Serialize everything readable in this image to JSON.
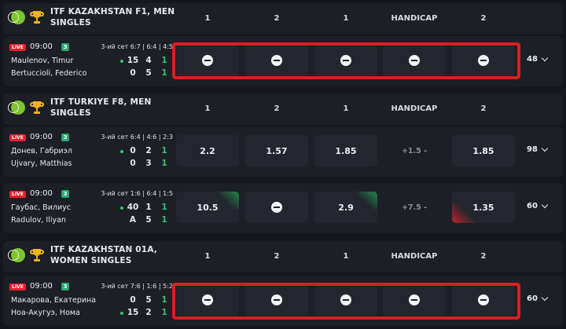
{
  "columns": [
    "1",
    "2",
    "1",
    "HANDICAP",
    "2"
  ],
  "sections": [
    {
      "title": "ITF KAZAKHSTAN F1, MEN SINGLES",
      "events": [
        {
          "live_badge": "LIVE",
          "time": "09:00",
          "live_icon_label": "3",
          "set_info": "3-ий сет 6:7 | 6:4 | 4:5",
          "home": "Maulenov, Timur",
          "away": "Bertuccioli, Federico",
          "home_score": [
            "15",
            "4",
            "1"
          ],
          "away_score": [
            "0",
            "5",
            "1"
          ],
          "serving": "home",
          "odds": [
            "locked",
            "locked",
            "locked",
            "locked",
            "locked"
          ],
          "more": "48"
        }
      ]
    },
    {
      "title": "ITF TURKIYE F8, MEN SINGLES",
      "events": [
        {
          "live_badge": "LIVE",
          "time": "09:00",
          "live_icon_label": "3",
          "set_info": "3-ий сет 6:4 | 4:6 | 2:3",
          "home": "Донев, Габриэл",
          "away": "Ujvary, Matthias",
          "home_score": [
            "0",
            "2",
            "1"
          ],
          "away_score": [
            "0",
            "3",
            "1"
          ],
          "serving": "home",
          "odds": [
            "2.2",
            "1.57",
            "1.85",
            "+1.5 -",
            "1.85"
          ],
          "more": "98"
        },
        {
          "live_badge": "LIVE",
          "time": "09:00",
          "live_icon_label": "3",
          "set_info": "3-ий сет 1:6 | 6:4 | 1:5",
          "home": "Гаубас, Вилиус",
          "away": "Radulov, Iliyan",
          "home_score": [
            "40",
            "1",
            "1"
          ],
          "away_score": [
            "A",
            "5",
            "1"
          ],
          "serving": "home",
          "odds": [
            "10.5",
            "locked",
            "2.9",
            "+7.5 -",
            "1.35"
          ],
          "more": "60"
        }
      ]
    },
    {
      "title": "ITF KAZAKHSTAN 01A, WOMEN SINGLES",
      "events": [
        {
          "live_badge": "LIVE",
          "time": "09:00",
          "live_icon_label": "3",
          "set_info": "3-ий сет 7:6 | 1:6 | 5:2",
          "home": "Макарова, Екатерина",
          "away": "Ноа-Акугуэ, Нома",
          "home_score": [
            "0",
            "5",
            "1"
          ],
          "away_score": [
            "15",
            "2",
            "1"
          ],
          "serving": "away",
          "odds": [
            "locked",
            "locked",
            "locked",
            "locked",
            "locked"
          ],
          "more": "60"
        }
      ]
    }
  ],
  "colors": {
    "background": "#15171c",
    "panel": "#1c1f26",
    "odd_cell": "#23262e",
    "live": "#e8202e",
    "green": "#36c26e",
    "highlight": "#d81f1f"
  }
}
